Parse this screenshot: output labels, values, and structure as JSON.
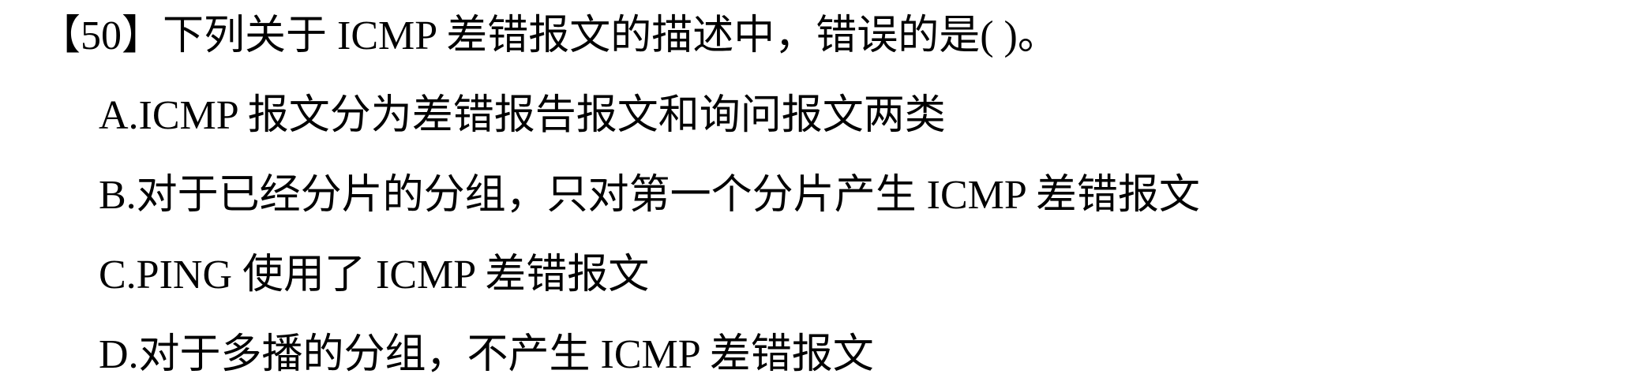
{
  "question": {
    "stem": "【50】下列关于 ICMP 差错报文的描述中，错误的是(      )。",
    "options": [
      "A.ICMP 报文分为差错报告报文和询问报文两类",
      "B.对于已经分片的分组，只对第一个分片产生 ICMP 差错报文",
      "C.PING 使用了 ICMP 差错报文",
      "D.对于多播的分组，不产生 ICMP 差错报文"
    ]
  }
}
